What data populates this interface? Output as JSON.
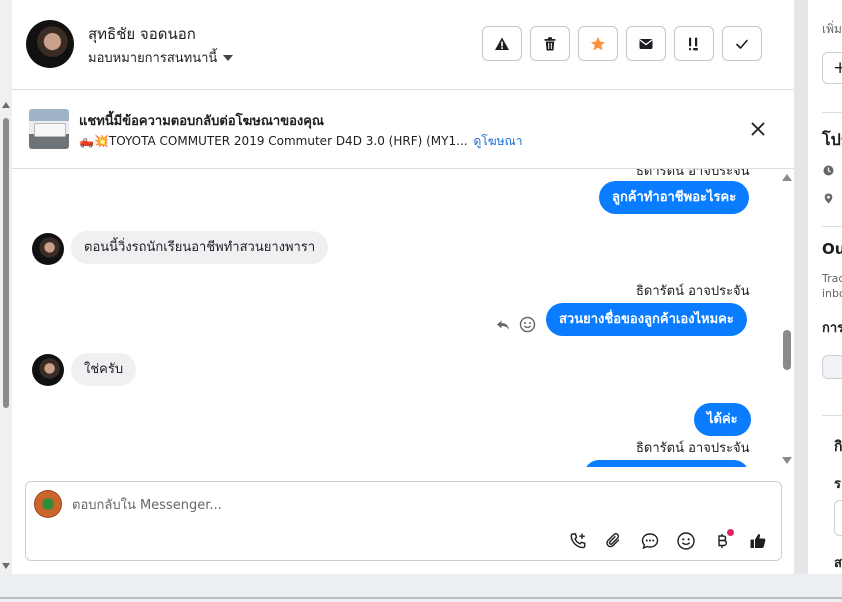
{
  "header": {
    "contact_name": "สุทธิชัย จอดนอก",
    "assign_label": "มอบหมายการสนทนานี้",
    "actions": [
      {
        "name": "report-spam-button",
        "icon": "warning-icon"
      },
      {
        "name": "delete-button",
        "icon": "trash-icon"
      },
      {
        "name": "star-button",
        "icon": "star-icon"
      },
      {
        "name": "mark-unread-button",
        "icon": "envelope-icon"
      },
      {
        "name": "follow-up-button",
        "icon": "priority-icon"
      },
      {
        "name": "mark-done-button",
        "icon": "check-icon"
      }
    ],
    "star_color": "#f7923a"
  },
  "ad": {
    "title": "แชทนี้มีข้อความตอบกลับต่อโฆษณาของคุณ",
    "subtitle": "🛻💥TOYOTA COMMUTER 2019 Commuter D4D 3.0 (HRF) (MY1...",
    "link": "ดูโฆษณา"
  },
  "messages": {
    "top_partial_sender": "ธิดารัตน์ อาจประจัน",
    "m1": "ลูกค้าทำอาชีพอะไรคะ",
    "m2": "ตอนนี้วิ่งรถนักเรียนอาชีพทำสวนยางพารา",
    "m3_sender": "ธิดารัตน์ อาจประจัน",
    "m3": "สวนยางชื่อของลูกค้าเองไหมคะ",
    "m4": "ใช่ครับ",
    "m5": "ได้ค่ะ",
    "m6_sender": "ธิดารัตน์ อาจประจัน"
  },
  "composer": {
    "placeholder": "ตอบกลับใน Messenger..."
  },
  "right_panel": {
    "t1": "เพิ่ม",
    "t2": "+",
    "t3": "โปร",
    "t4": "Ou",
    "t5": "Trac",
    "t6": "inbo",
    "t7": "การ",
    "t8": "กิ",
    "t9": "ร",
    "t10": "ส"
  },
  "colors": {
    "accent": "#0a7cff",
    "link": "#1a6ed8",
    "notification_dot": "#e0245e"
  }
}
